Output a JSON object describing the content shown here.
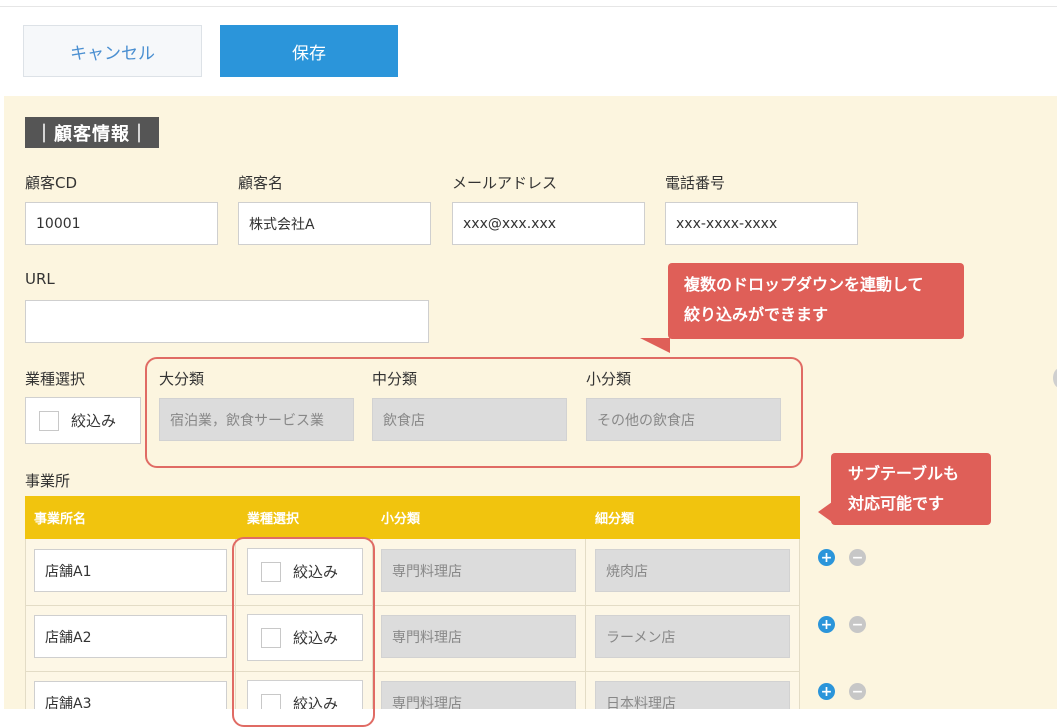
{
  "toolbar": {
    "cancel_label": "キャンセル",
    "save_label": "保存"
  },
  "section": {
    "title": "｜顧客情報｜"
  },
  "fields": {
    "customer_cd": {
      "label": "顧客CD",
      "value": "10001"
    },
    "customer_name": {
      "label": "顧客名",
      "value": "株式会社A"
    },
    "email": {
      "label": "メールアドレス",
      "value": "xxx@xxx.xxx"
    },
    "phone": {
      "label": "電話番号",
      "value": "xxx-xxxx-xxxx"
    },
    "url": {
      "label": "URL",
      "value": ""
    }
  },
  "industry": {
    "label": "業種選択",
    "filter_label": "絞込み",
    "major": {
      "label": "大分類",
      "value": "宿泊業，飲食サービス業"
    },
    "middle": {
      "label": "中分類",
      "value": "飲食店"
    },
    "minor": {
      "label": "小分類",
      "value": "その他の飲食店"
    }
  },
  "callouts": {
    "dropdown_line1": "複数のドロップダウンを連動して",
    "dropdown_line2": "絞り込みができます",
    "subtable_line1": "サブテーブルも",
    "subtable_line2": "対応可能です"
  },
  "offices": {
    "label": "事業所",
    "headers": [
      "事業所名",
      "業種選択",
      "小分類",
      "細分類"
    ],
    "rows": [
      {
        "name": "店舗A1",
        "filter": "絞込み",
        "minor": "専門料理店",
        "detail": "焼肉店"
      },
      {
        "name": "店舗A2",
        "filter": "絞込み",
        "minor": "専門料理店",
        "detail": "ラーメン店"
      },
      {
        "name": "店舗A3",
        "filter": "絞込み",
        "minor": "専門料理店",
        "detail": "日本料理店"
      }
    ],
    "add_symbol": "+",
    "remove_symbol": "−"
  },
  "colors": {
    "accent": "#2b95da",
    "header": "#f1c40e",
    "callout": "#df5f58",
    "panel": "#fcf5df"
  }
}
